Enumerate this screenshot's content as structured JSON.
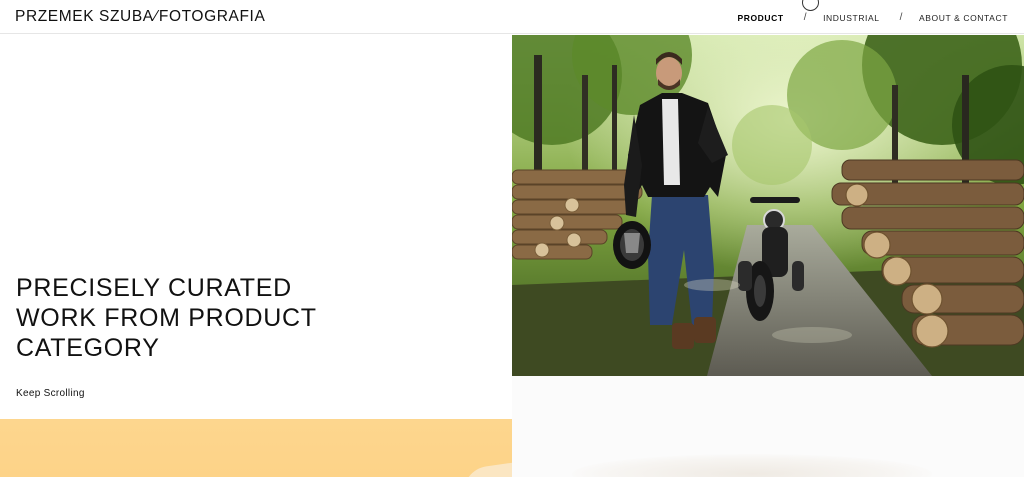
{
  "header": {
    "logo_left": "PRZEMEK SZUBA",
    "logo_separator": "⁄",
    "logo_right": "FOTOGRAFIA",
    "nav": [
      {
        "label": "PRODUCT",
        "active": true
      },
      {
        "label": "INDUSTRIAL",
        "active": false
      },
      {
        "label": "ABOUT & CONTACT",
        "active": false
      }
    ],
    "nav_separator": "/"
  },
  "intro": {
    "headline_lines": [
      "PRECISELY CURATED",
      "WORK FROM PRODUCT",
      "CATEGORY"
    ],
    "keep_scrolling": "Keep Scrolling"
  },
  "colors": {
    "accent_block": "#fdd68e",
    "text": "#111111",
    "background": "#ffffff"
  }
}
